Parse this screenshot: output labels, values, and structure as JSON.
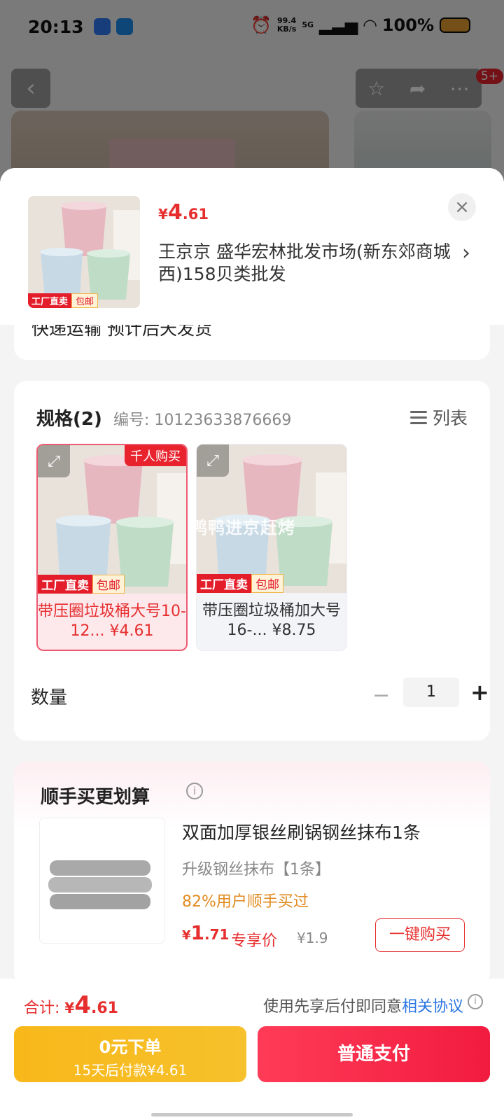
{
  "status_bar": {
    "time": "20:13",
    "net_speed_value": "99.4",
    "net_speed_unit": "KB/s",
    "network": "5G",
    "battery": "100%"
  },
  "background_nav": {
    "back_icon": "chevron-left-icon",
    "favorite_icon": "star-icon",
    "share_icon": "share-icon",
    "more_icon": "more-icon",
    "badge": "5+"
  },
  "sheet": {
    "price": {
      "currency": "¥",
      "integer": "4",
      "decimal": ".61"
    },
    "address": "王京京  盛华宏林批发市场(新东郊商城西)158贝类批发",
    "thumb_tags": {
      "factory": "工厂直卖",
      "free_ship": "包邮"
    },
    "shipping": "快递运输 预计后天发货",
    "spec": {
      "title": "规格(2)",
      "code": "编号: 10123633876669",
      "list_toggle": "列表",
      "options": [
        {
          "label": "带压圈垃圾桶大号10-12... ¥4.61",
          "hot_badge": "千人购买",
          "selected": true
        },
        {
          "label": "带压圈垃圾桶加大号16-... ¥8.75",
          "selected": false
        }
      ],
      "watermark": "鸭鸭进京赶烤"
    },
    "quantity": {
      "label": "数量",
      "value": "1",
      "minus": "−",
      "plus": "+"
    },
    "upsell": {
      "title": "顺手买更划算",
      "product_name": "双面加厚银丝刷锅钢丝抹布1条",
      "variant": "升级钢丝抹布【1条】",
      "bought_rate": "82%用户顺手买过",
      "price": {
        "currency": "¥",
        "integer": "1",
        "decimal": ".71"
      },
      "price_tag": "专享价",
      "original_price": "¥1.9",
      "buy_button": "一键购买"
    }
  },
  "bottom_bar": {
    "total_label": "合计: ",
    "total": {
      "currency": "¥",
      "integer": "4",
      "decimal": ".61"
    },
    "agreement_text": "使用先享后付即同意",
    "agreement_link": "相关协议",
    "pay_later_main": "0元下单",
    "pay_later_sub": "15天后付款¥4.61",
    "pay_now": "普通支付"
  },
  "colors": {
    "accent_red": "#e62e2e",
    "pay_later_yellow": "#f8b81a",
    "pay_now_red": "#ff3b57",
    "link_blue": "#2a76e0"
  }
}
